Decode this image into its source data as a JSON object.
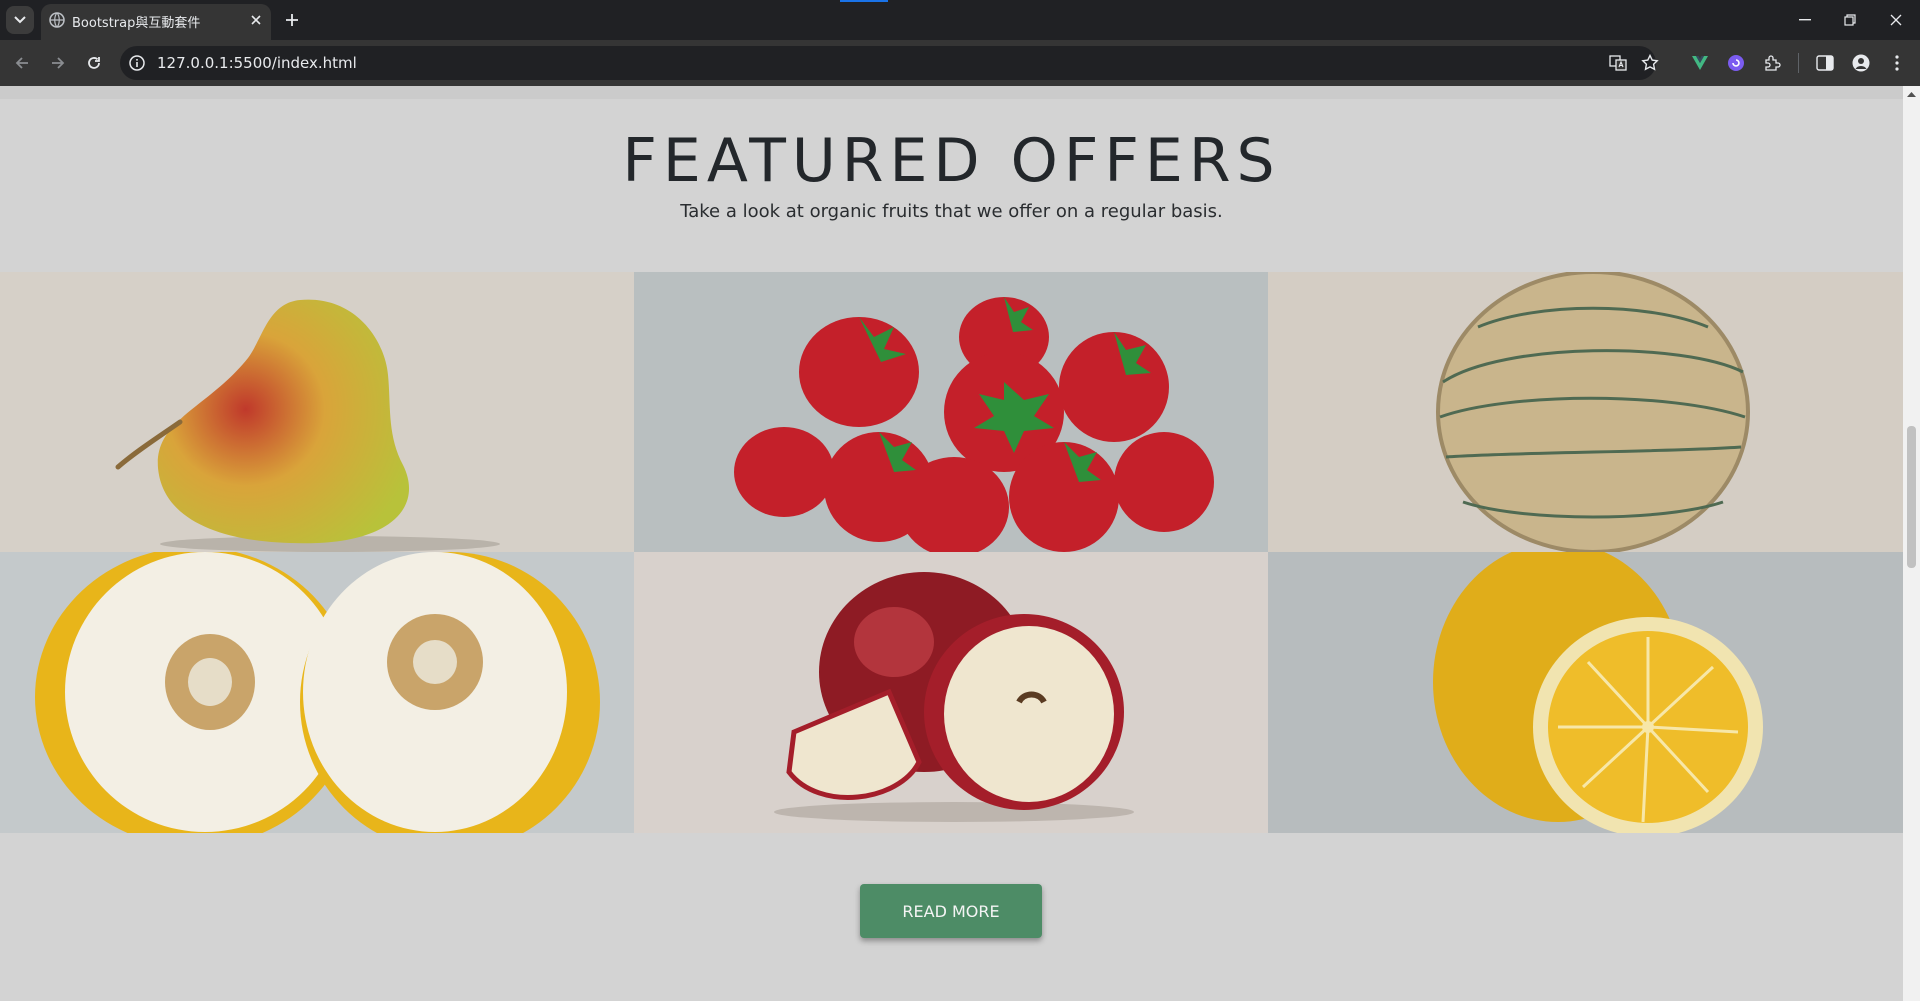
{
  "browser": {
    "tab_title": "Bootstrap與互動套件",
    "url": "127.0.0.1:5500/index.html",
    "icons": [
      "tab-search-icon",
      "globe-icon",
      "close-icon",
      "plus-icon",
      "minimize-icon",
      "restore-icon",
      "window-close-icon",
      "back-icon",
      "forward-icon",
      "reload-icon",
      "site-info-icon",
      "translate-icon",
      "bookmark-star-icon",
      "vue-devtools-icon",
      "extension-icon",
      "puzzle-icon",
      "side-panel-icon",
      "profile-icon",
      "menu-icon"
    ]
  },
  "page": {
    "heading": "FEATURED OFFERS",
    "subtext": "Take a look at organic fruits that we offer on a regular basis.",
    "button_label": "READ MORE",
    "colors": {
      "background": "#d3d3d3",
      "button": "#4d8c66",
      "heading": "#23272b"
    },
    "offers": [
      {
        "fruit": "pear"
      },
      {
        "fruit": "strawberries"
      },
      {
        "fruit": "cantaloupe"
      },
      {
        "fruit": "yellow melon"
      },
      {
        "fruit": "apple"
      },
      {
        "fruit": "lemon"
      }
    ]
  }
}
